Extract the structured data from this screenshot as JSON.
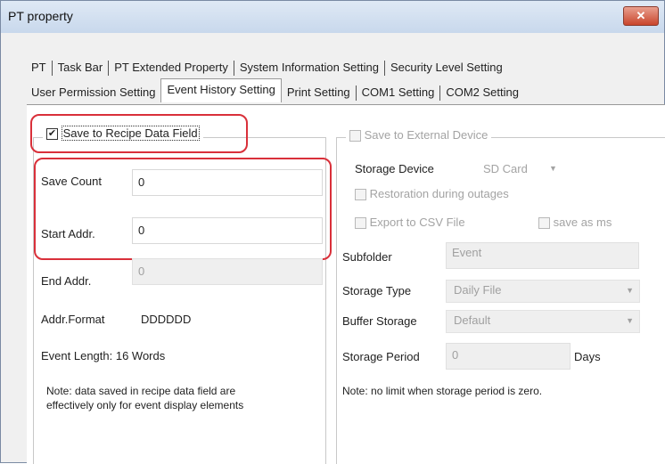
{
  "window": {
    "title": "PT property",
    "close_symbol": "✕"
  },
  "tabs_row1": [
    "PT",
    "Task Bar",
    "PT Extended Property",
    "System Information Setting",
    "Security Level Setting"
  ],
  "tabs_row2": [
    "User Permission Setting",
    "Event History Setting",
    "Print Setting",
    "COM1 Setting",
    "COM2 Setting"
  ],
  "active_tab": "Event History Setting",
  "left": {
    "group_checkbox": {
      "label": "Save to Recipe Data Field",
      "checked": true
    },
    "save_count": {
      "label": "Save Count",
      "value": "0"
    },
    "start_addr": {
      "label": "Start Addr.",
      "value": "0"
    },
    "end_addr": {
      "label": "End Addr.",
      "value": "0"
    },
    "addr_format": {
      "label": "Addr.Format",
      "value": "DDDDDD"
    },
    "event_length": "Event Length: 16 Words",
    "note_line1": "Note: data saved in recipe data field are",
    "note_line2": "effectively only for event display elements"
  },
  "right": {
    "group_checkbox": {
      "label": "Save to External Device",
      "checked": false
    },
    "storage_device": {
      "label": "Storage Device",
      "value": "SD Card"
    },
    "restoration": "Restoration during outages",
    "export_csv": "Export to CSV File",
    "save_as_ms": "save as ms",
    "subfolder": {
      "label": "Subfolder",
      "value": "Event"
    },
    "storage_type": {
      "label": "Storage Type",
      "value": "Daily File"
    },
    "buffer_storage": {
      "label": "Buffer Storage",
      "value": "Default"
    },
    "storage_period": {
      "label": "Storage Period",
      "value": "0",
      "unit": "Days"
    },
    "note": "Note: no limit when storage period is zero."
  },
  "colors": {
    "highlight": "#d9303a",
    "close_button": "#c9452c"
  }
}
